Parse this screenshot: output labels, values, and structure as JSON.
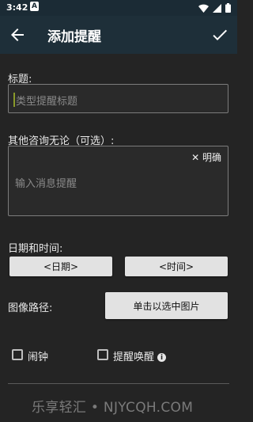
{
  "status": {
    "time": "3:42",
    "notification_letter": "A"
  },
  "toolbar": {
    "title": "添加提醒"
  },
  "form": {
    "title_label": "标题:",
    "title_placeholder": "类型提醒标题",
    "message_label": "其他咨询无论（可选）:",
    "message_placeholder": "输入消息提醒",
    "clear_label": "✕ 明确",
    "datetime_label": "日期和时间:",
    "date_button": "<日期>",
    "time_button": "<时间>",
    "image_label": "图像路径:",
    "image_button": "单击以选中图片",
    "alarm_label": "闹钟",
    "wakeup_label": "提醒唤醒",
    "info_icon_glyph": "i"
  },
  "watermark": "乐享轻汇 • NJYCQH.COM"
}
